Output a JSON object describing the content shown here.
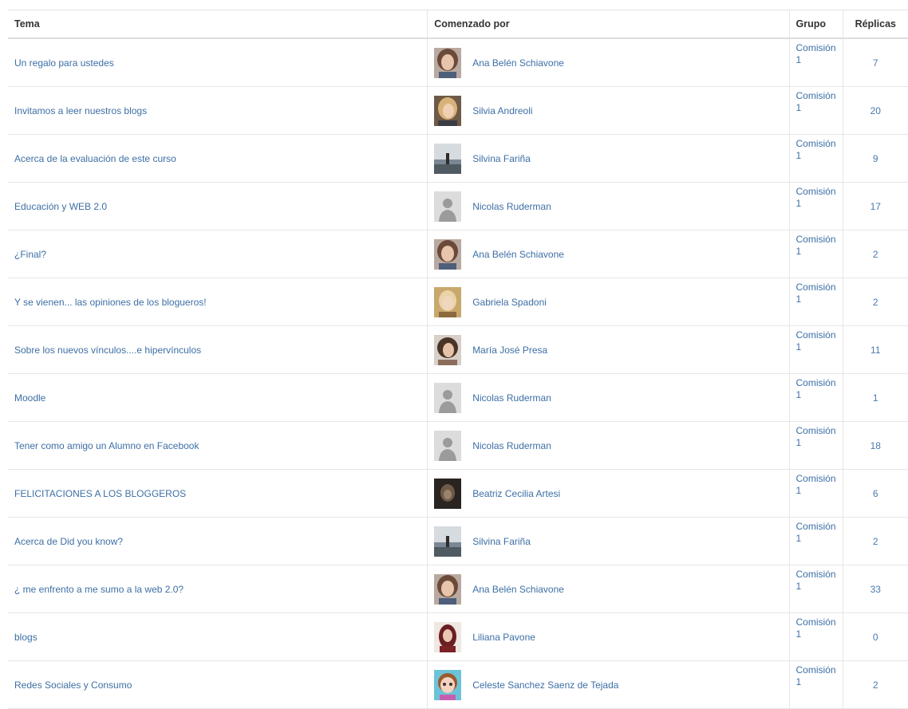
{
  "headers": {
    "topic": "Tema",
    "author": "Comenzado por",
    "group": "Grupo",
    "replies": "Réplicas"
  },
  "rows": [
    {
      "topic": "Un regalo para ustedes",
      "author": "Ana Belén Schiavone",
      "group_line1": "Comisión",
      "group_line2": "1",
      "replies": "7",
      "avatar": "avatar-photo-woman-curly"
    },
    {
      "topic": "Invitamos a leer nuestros blogs",
      "author": "Silvia Andreoli",
      "group_line1": "Comisión",
      "group_line2": "1",
      "replies": "20",
      "avatar": "avatar-photo-woman-blonde"
    },
    {
      "topic": "Acerca de la evaluación de este curso",
      "author": "Silvina Fariña",
      "group_line1": "Comisión",
      "group_line2": "1",
      "replies": "9",
      "avatar": "avatar-photo-landscape"
    },
    {
      "topic": "Educación y WEB 2.0",
      "author": "Nicolas Ruderman",
      "group_line1": "Comisión",
      "group_line2": "1",
      "replies": "17",
      "avatar": "avatar-default-silhouette"
    },
    {
      "topic": "¿Final?",
      "author": "Ana Belén Schiavone",
      "group_line1": "Comisión",
      "group_line2": "1",
      "replies": "2",
      "avatar": "avatar-photo-woman-curly"
    },
    {
      "topic": "Y se vienen... las opiniones de los blogueros!",
      "author": "Gabriela Spadoni",
      "group_line1": "Comisión",
      "group_line2": "1",
      "replies": "2",
      "avatar": "avatar-photo-woman-light"
    },
    {
      "topic": "Sobre los nuevos vínculos....e hipervínculos",
      "author": "María José Presa",
      "group_line1": "Comisión",
      "group_line2": "1",
      "replies": "11",
      "avatar": "avatar-photo-woman-dark-hair"
    },
    {
      "topic": "Moodle",
      "author": "Nicolas Ruderman",
      "group_line1": "Comisión",
      "group_line2": "1",
      "replies": "1",
      "avatar": "avatar-default-silhouette"
    },
    {
      "topic": "Tener como amigo un Alumno en Facebook",
      "author": "Nicolas Ruderman",
      "group_line1": "Comisión",
      "group_line2": "1",
      "replies": "18",
      "avatar": "avatar-default-silhouette"
    },
    {
      "topic": "FELICITACIONES A LOS BLOGGEROS",
      "author": "Beatriz Cecilia Artesi",
      "group_line1": "Comisión",
      "group_line2": "1",
      "replies": "6",
      "avatar": "avatar-photo-dark"
    },
    {
      "topic": "Acerca de Did you know?",
      "author": "Silvina Fariña",
      "group_line1": "Comisión",
      "group_line2": "1",
      "replies": "2",
      "avatar": "avatar-photo-landscape"
    },
    {
      "topic": "¿ me enfrento a me sumo a la web 2.0?",
      "author": "Ana Belén Schiavone",
      "group_line1": "Comisión",
      "group_line2": "1",
      "replies": "33",
      "avatar": "avatar-photo-woman-curly"
    },
    {
      "topic": "blogs",
      "author": "Liliana Pavone",
      "group_line1": "Comisión",
      "group_line2": "1",
      "replies": "0",
      "avatar": "avatar-photo-woman-red"
    },
    {
      "topic": "Redes Sociales y Consumo",
      "author": "Celeste Sanchez Saenz de Tejada",
      "group_line1": "Comisión",
      "group_line2": "1",
      "replies": "2",
      "avatar": "avatar-cartoon-girl"
    }
  ],
  "colors": {
    "link": "#3d6fa5",
    "header_text": "#333333",
    "row_border": "#e6e6e6"
  }
}
